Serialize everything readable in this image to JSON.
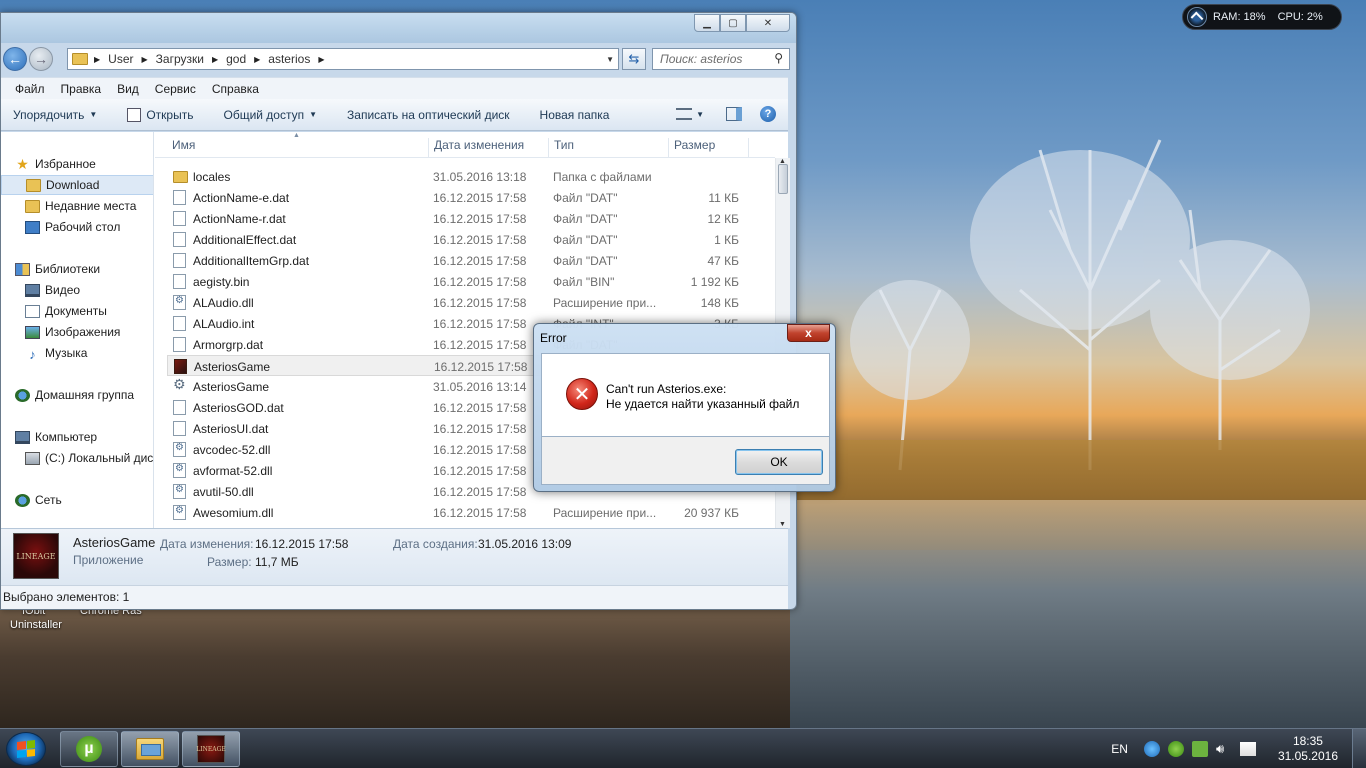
{
  "desktop": {
    "icon_labels": [
      "IObit",
      "Uninstaller",
      "Chrome Ras"
    ]
  },
  "sysmeter": {
    "ram": "RAM: 18%",
    "cpu": "CPU: 2%"
  },
  "explorer": {
    "path": [
      "User",
      "Загрузки",
      "god",
      "asterios"
    ],
    "search_placeholder": "Поиск: asterios",
    "menu": [
      "Файл",
      "Правка",
      "Вид",
      "Сервис",
      "Справка"
    ],
    "toolbar": {
      "organize": "Упорядочить",
      "open": "Открыть",
      "share": "Общий доступ",
      "burn": "Записать на оптический диск",
      "new_folder": "Новая папка"
    },
    "nav": {
      "favorites": "Избранное",
      "download": "Download",
      "recent": "Недавние места",
      "desktop": "Рабочий стол",
      "libraries": "Библиотеки",
      "video": "Видео",
      "documents": "Документы",
      "images": "Изображения",
      "music": "Музыка",
      "homegroup": "Домашняя группа",
      "computer": "Компьютер",
      "local_disk": "(C:) Локальный диск",
      "network": "Сеть"
    },
    "columns": {
      "name": "Имя",
      "date": "Дата изменения",
      "type": "Тип",
      "size": "Размер"
    },
    "files": [
      {
        "name": "locales",
        "date": "31.05.2016 13:18",
        "type": "Папка с файлами",
        "size": "",
        "icon": "folder"
      },
      {
        "name": "ActionName-e.dat",
        "date": "16.12.2015 17:58",
        "type": "Файл \"DAT\"",
        "size": "11 КБ",
        "icon": "file"
      },
      {
        "name": "ActionName-r.dat",
        "date": "16.12.2015 17:58",
        "type": "Файл \"DAT\"",
        "size": "12 КБ",
        "icon": "file"
      },
      {
        "name": "AdditionalEffect.dat",
        "date": "16.12.2015 17:58",
        "type": "Файл \"DAT\"",
        "size": "1 КБ",
        "icon": "file"
      },
      {
        "name": "AdditionalItemGrp.dat",
        "date": "16.12.2015 17:58",
        "type": "Файл \"DAT\"",
        "size": "47 КБ",
        "icon": "file"
      },
      {
        "name": "aegisty.bin",
        "date": "16.12.2015 17:58",
        "type": "Файл \"BIN\"",
        "size": "1 192 КБ",
        "icon": "file"
      },
      {
        "name": "ALAudio.dll",
        "date": "16.12.2015 17:58",
        "type": "Расширение при...",
        "size": "148 КБ",
        "icon": "dll"
      },
      {
        "name": "ALAudio.int",
        "date": "16.12.2015 17:58",
        "type": "Файл \"INT\"",
        "size": "3 КБ",
        "icon": "file"
      },
      {
        "name": "Armorgrp.dat",
        "date": "16.12.2015 17:58",
        "type": "Файл \"DAT\"",
        "size": "",
        "icon": "file"
      },
      {
        "name": "AsteriosGame",
        "date": "16.12.2015 17:58",
        "type": "",
        "size": "",
        "icon": "exe"
      },
      {
        "name": "AsteriosGame",
        "date": "31.05.2016 13:14",
        "type": "",
        "size": "",
        "icon": "gear"
      },
      {
        "name": "AsteriosGOD.dat",
        "date": "16.12.2015 17:58",
        "type": "",
        "size": "",
        "icon": "file"
      },
      {
        "name": "AsteriosUI.dat",
        "date": "16.12.2015 17:58",
        "type": "",
        "size": "",
        "icon": "file"
      },
      {
        "name": "avcodec-52.dll",
        "date": "16.12.2015 17:58",
        "type": "",
        "size": "",
        "icon": "dll"
      },
      {
        "name": "avformat-52.dll",
        "date": "16.12.2015 17:58",
        "type": "",
        "size": "",
        "icon": "dll"
      },
      {
        "name": "avutil-50.dll",
        "date": "16.12.2015 17:58",
        "type": "",
        "size": "",
        "icon": "dll"
      },
      {
        "name": "Awesomium.dll",
        "date": "16.12.2015 17:58",
        "type": "Расширение при...",
        "size": "20 937 КБ",
        "icon": "dll"
      }
    ],
    "details": {
      "name": "AsteriosGame",
      "kind": "Приложение",
      "modified_label": "Дата изменения:",
      "modified": "16.12.2015 17:58",
      "created_label": "Дата создания:",
      "created": "31.05.2016 13:09",
      "size_label": "Размер:",
      "size": "11,7 МБ",
      "thumb_text": "LINEAGE"
    },
    "status": "Выбрано элементов: 1"
  },
  "dialog": {
    "title": "Error",
    "line1": "Can't run Asterios.exe:",
    "line2": "Не удается найти указанный файл",
    "ok": "OK",
    "close": "x"
  },
  "taskbar": {
    "lang": "EN",
    "time": "18:35",
    "date": "31.05.2016",
    "utorrent": "µ",
    "l2_label": "LINEAGE"
  },
  "colors": {
    "accent": "#1e6ab8",
    "error": "#d1261a"
  }
}
